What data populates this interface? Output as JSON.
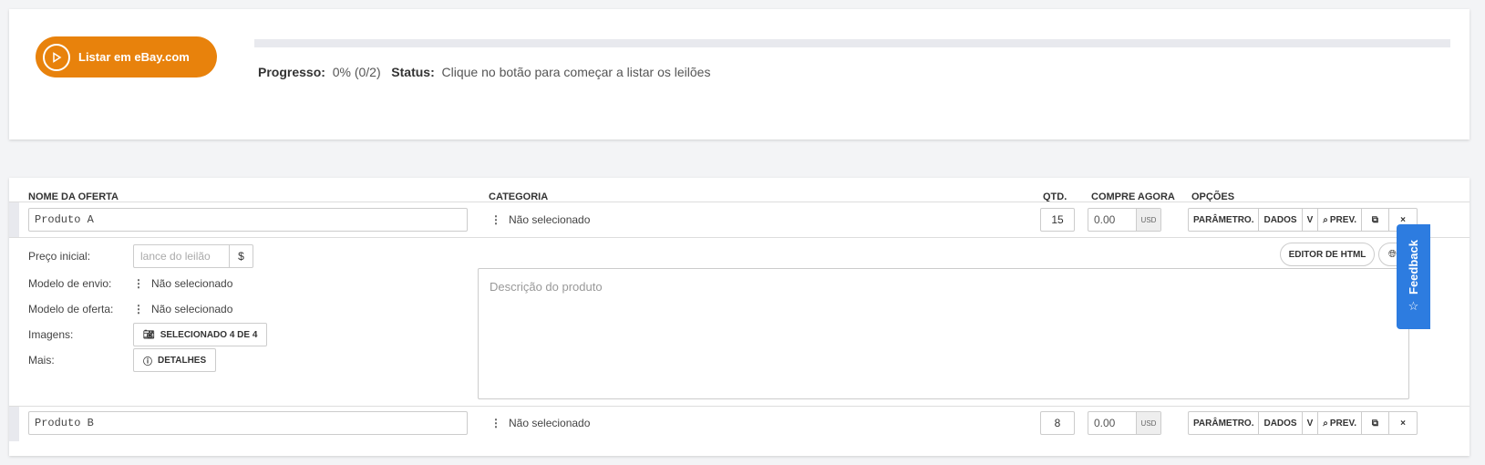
{
  "top": {
    "list_button": "Listar em eBay.com",
    "progress_label": "Progresso:",
    "progress_value": "0% (0/2)",
    "progress_fraction": 0,
    "status_label": "Status:",
    "status_value": "Clique no botão para começar a listar os leilões"
  },
  "table": {
    "headers": {
      "name": "NOME DA OFERTA",
      "category": "CATEGORIA",
      "qty": "QTD.",
      "buy_now": "COMPRE AGORA",
      "options": "OPÇÕES"
    },
    "rows": [
      {
        "name": "Produto A",
        "category": "Não selecionado",
        "qty": "15",
        "price": "0.00",
        "currency": "USD"
      },
      {
        "name": "Produto B",
        "category": "Não selecionado",
        "qty": "8",
        "price": "0.00",
        "currency": "USD"
      }
    ],
    "options": {
      "params": "PARÂMETRO.",
      "data": "DADOS",
      "v": "V",
      "preview": "PREV.",
      "copy_icon": "copy-icon",
      "close": "×"
    }
  },
  "detail": {
    "start_price_label": "Preço inicial:",
    "start_price_placeholder": "lance do leilão",
    "start_price_currency": "$",
    "shipping_label": "Modelo de envio:",
    "shipping_value": "Não selecionado",
    "offer_label": "Modelo de oferta:",
    "offer_value": "Não selecionado",
    "images_label": "Imagens:",
    "images_button": "SELECIONADO 4 DE 4",
    "more_label": "Mais:",
    "details_button": "DETALHES",
    "html_editor_button": "EDITOR DE HTML",
    "description_placeholder": "Descrição do produto"
  },
  "feedback": {
    "label": "Feedback"
  },
  "colors": {
    "accent": "#e8820c",
    "feedback": "#2d7ce0"
  }
}
